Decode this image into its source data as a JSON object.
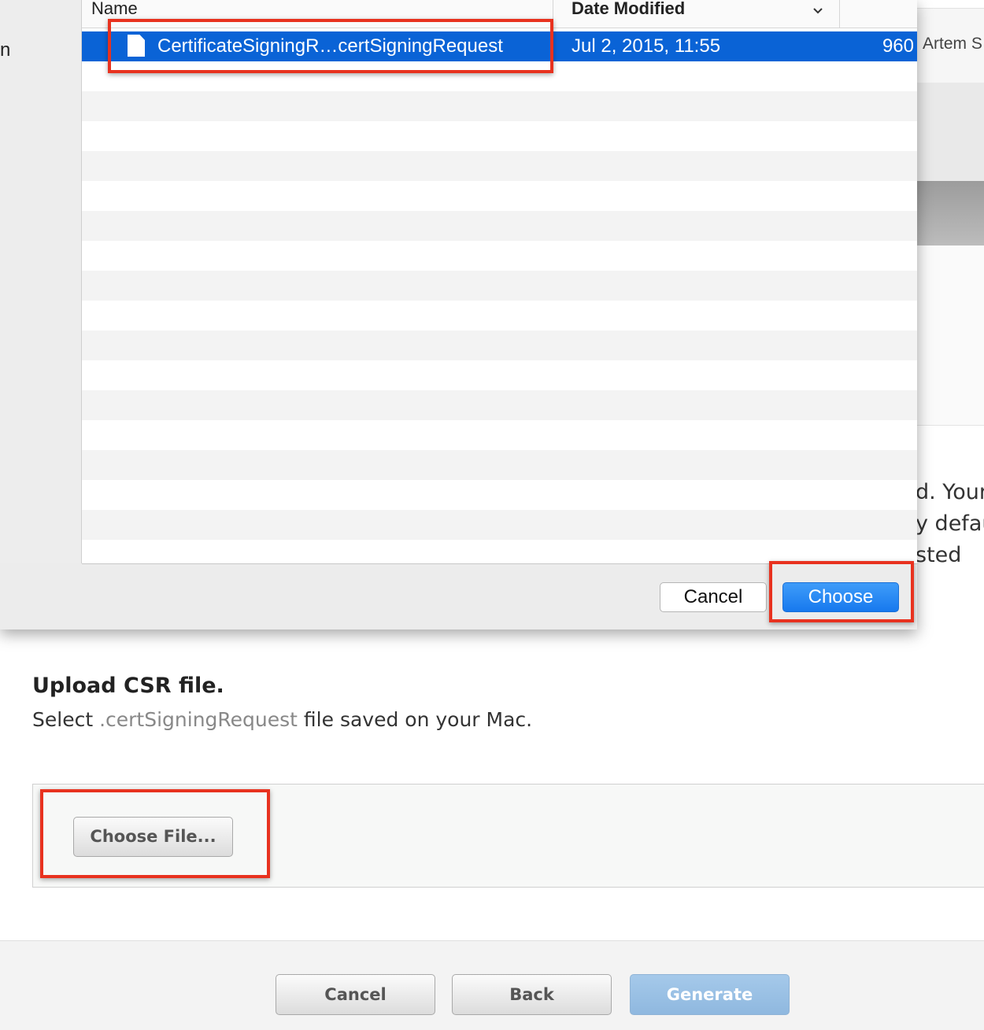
{
  "background_page": {
    "user_name": "Artem S",
    "text_fragments": [
      "d. Your",
      "y defau",
      "sted"
    ],
    "upload": {
      "title": "Upload CSR file.",
      "desc_prefix": "Select ",
      "desc_ext": ".certSigningRequest",
      "desc_suffix": " file saved on your Mac.",
      "choose_file_label": "Choose File..."
    },
    "footer": {
      "cancel_label": "Cancel",
      "back_label": "Back",
      "generate_label": "Generate"
    }
  },
  "dialog": {
    "sidebar_fragment": "n",
    "columns": {
      "name": "Name",
      "date_modified": "Date Modified"
    },
    "selected_file": {
      "name": "CertificateSigningR…certSigningRequest",
      "date": "Jul 2, 2015, 11:55",
      "size": "960"
    },
    "empty_row_count": 17,
    "cancel_label": "Cancel",
    "choose_label": "Choose"
  },
  "colors": {
    "selection": "#0a63d6",
    "primary_button": "#1779ee",
    "highlight_annotation": "#e8321f",
    "generate_disabled": "#9dc2e6"
  }
}
